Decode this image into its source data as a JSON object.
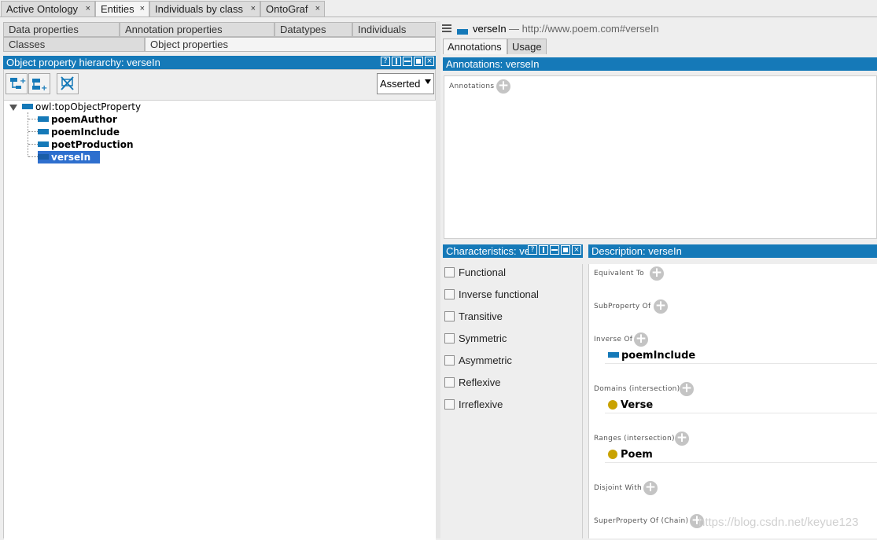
{
  "top_tabs": [
    {
      "label": "Active Ontology",
      "close": "×"
    },
    {
      "label": "Entities",
      "close": "×"
    },
    {
      "label": "Individuals by class",
      "close": "×"
    },
    {
      "label": "OntoGraf",
      "close": "×"
    }
  ],
  "entity_tabs": {
    "row1": [
      "Data properties",
      "Annotation properties",
      "Datatypes",
      "Individuals"
    ],
    "row2": [
      "Classes",
      "Object properties"
    ]
  },
  "hierarchy": {
    "header": "Object property hierarchy: verseIn",
    "window_buttons": [
      "?",
      "▯",
      "▭",
      "▣",
      "×"
    ],
    "mode": "Asserted",
    "root": "owl:topObjectProperty",
    "children": [
      "poemAuthor",
      "poemInclude",
      "poetProduction",
      "verseIn"
    ],
    "selected": "verseIn"
  },
  "entity": {
    "name": "verseIn",
    "iri": "— http://www.poem.com#verseIn"
  },
  "right_tabs": [
    "Annotations",
    "Usage"
  ],
  "annotations": {
    "header": "Annotations: verseIn",
    "label": "Annotations"
  },
  "characteristics": {
    "header": "Characteristics: ve",
    "items": [
      "Functional",
      "Inverse functional",
      "Transitive",
      "Symmetric",
      "Asymmetric",
      "Reflexive",
      "Irreflexive"
    ]
  },
  "description": {
    "header": "Description: verseIn",
    "sections": {
      "equivalent": "Equivalent To",
      "subproperty": "SubProperty Of",
      "inverse": "Inverse Of",
      "inverse_value": "poemInclude",
      "domains": "Domains (intersection)",
      "domains_value": "Verse",
      "ranges": "Ranges (intersection)",
      "ranges_value": "Poem",
      "disjoint": "Disjoint With",
      "superchain": "SuperProperty Of (Chain)"
    }
  },
  "plus_glyph": "+",
  "watermark": "https://blog.csdn.net/keyue123",
  "colors": {
    "accent": "#1579b8",
    "class_dot": "#c9a200"
  }
}
